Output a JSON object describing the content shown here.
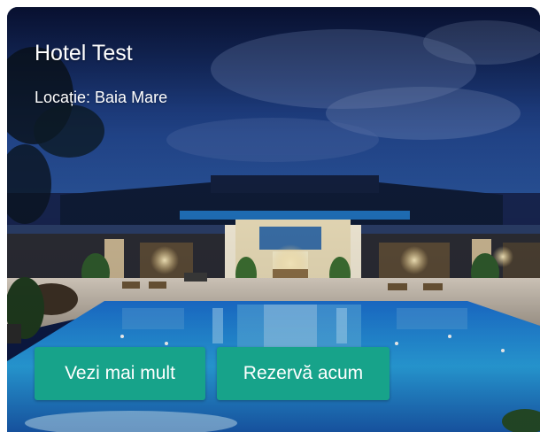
{
  "hotel_card": {
    "name": "Hotel Test",
    "location": "Locație: Baia Mare",
    "photo_icon": "hotel-photo",
    "actions": {
      "details_label": "Vezi mai mult",
      "book_label": "Rezervă acum"
    }
  },
  "colors": {
    "button_bg": "#17a38a",
    "button_text": "#ffffff",
    "title_text": "#ffffff",
    "sky_top": "#0c1a44",
    "pool_water": "#2aa6e6"
  }
}
